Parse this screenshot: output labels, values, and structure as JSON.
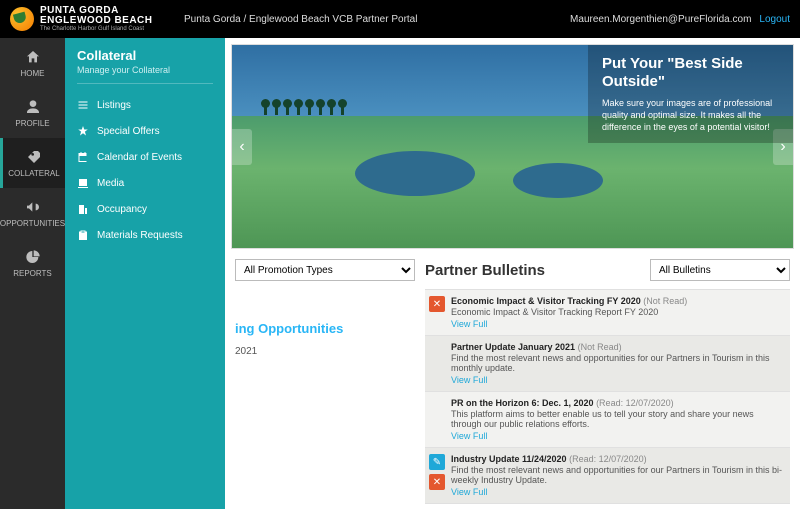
{
  "brand": {
    "line1": "PUNTA GORDA",
    "line2": "ENGLEWOOD BEACH",
    "tagline": "The Charlotte Harbor Gulf Island Coast"
  },
  "header": {
    "title": "Punta Gorda / Englewood Beach VCB Partner Portal",
    "user": "Maureen.Morgenthien@PureFlorida.com",
    "logout": "Logout"
  },
  "nav": {
    "home": "HOME",
    "profile": "PROFILE",
    "collateral": "COLLATERAL",
    "opportunities": "OPPORTUNITIES",
    "reports": "REPORTS"
  },
  "submenu": {
    "title": "Collateral",
    "desc": "Manage your Collateral",
    "items": [
      "Listings",
      "Special Offers",
      "Calendar of Events",
      "Media",
      "Occupancy",
      "Materials Requests"
    ]
  },
  "hero": {
    "title": "Put Your \"Best Side Outside\"",
    "desc": "Make sure your images are of professional quality and optimal size. It makes all the difference in the eyes of a potential visitor!"
  },
  "promo": {
    "select": "All Promotion Types",
    "opp_heading": "ing Opportunities",
    "opp_date": "2021"
  },
  "bulletins": {
    "heading": "Partner Bulletins",
    "filter": "All Bulletins",
    "items": [
      {
        "icon": "del",
        "title": "Economic Impact & Visitor Tracking FY 2020",
        "status": "(Not Read)",
        "desc": "Economic Impact & Visitor Tracking Report FY 2020",
        "view": "View Full"
      },
      {
        "icon": "",
        "title": "Partner Update January 2021",
        "status": "(Not Read)",
        "desc": "Find the most relevant news and opportunities for our Partners in Tourism in this monthly update.",
        "view": "View Full"
      },
      {
        "icon": "",
        "title": "PR on the Horizon 6: Dec. 1, 2020",
        "status": "(Read: 12/07/2020)",
        "desc": "This platform aims to better enable us to tell your story and share your news through our public relations efforts.",
        "view": "View Full"
      },
      {
        "icon": "edit",
        "title": "Industry Update 11/24/2020",
        "status": "(Read: 12/07/2020)",
        "desc": "Find the most relevant news and opportunities for our Partners in Tourism in this bi-weekly Industry Update.",
        "view": "View Full"
      }
    ]
  }
}
